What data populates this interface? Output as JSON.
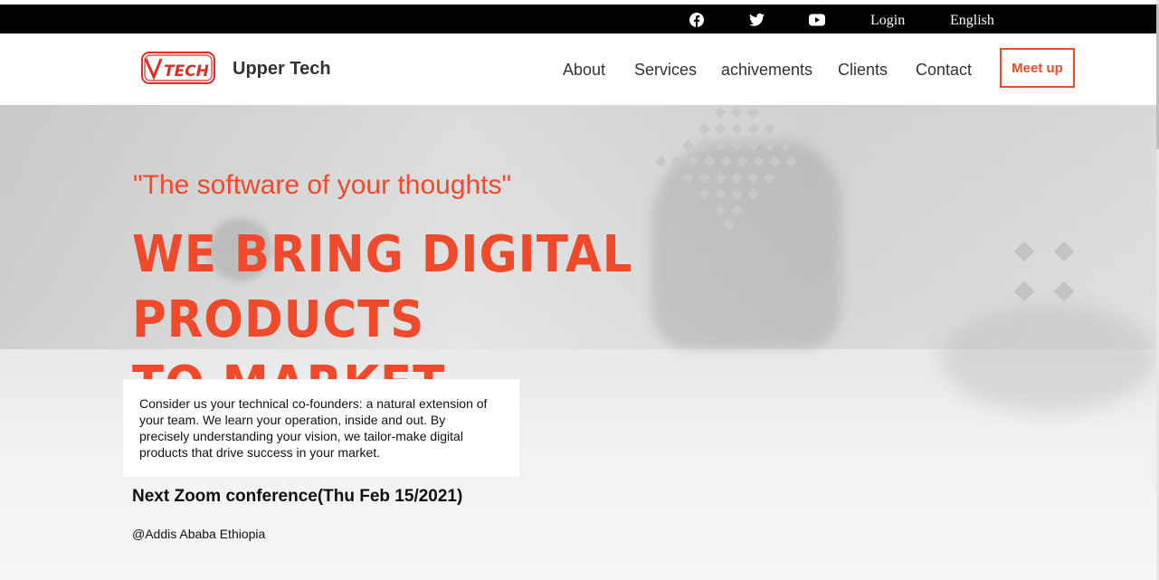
{
  "topbar": {
    "social": [
      "facebook-icon",
      "twitter-icon",
      "youtube-icon"
    ],
    "login_label": "Login",
    "language_label": "English"
  },
  "header": {
    "logo_text": "TECH",
    "brand_name": "Upper Tech",
    "nav": [
      "About",
      "Services",
      "achivements",
      "Clients",
      "Contact"
    ],
    "meetup_label": "Meet up"
  },
  "hero": {
    "tagline": "\"The software of your thoughts\"",
    "headline_line1": "WE BRING DIGITAL PRODUCTS",
    "headline_line2": "TO MARKET.",
    "description": "Consider us your technical co-founders: a natural extension of your team. We learn your operation, inside and out. By precisely understanding your vision, we tailor-make digital products that drive success in your market.",
    "event": "Next Zoom conference(Thu Feb 15/2021)",
    "location": "@Addis Ababa Ethiopia"
  },
  "colors": {
    "accent": "#f04a2c",
    "topbar": "#000000",
    "text": "#333333"
  }
}
